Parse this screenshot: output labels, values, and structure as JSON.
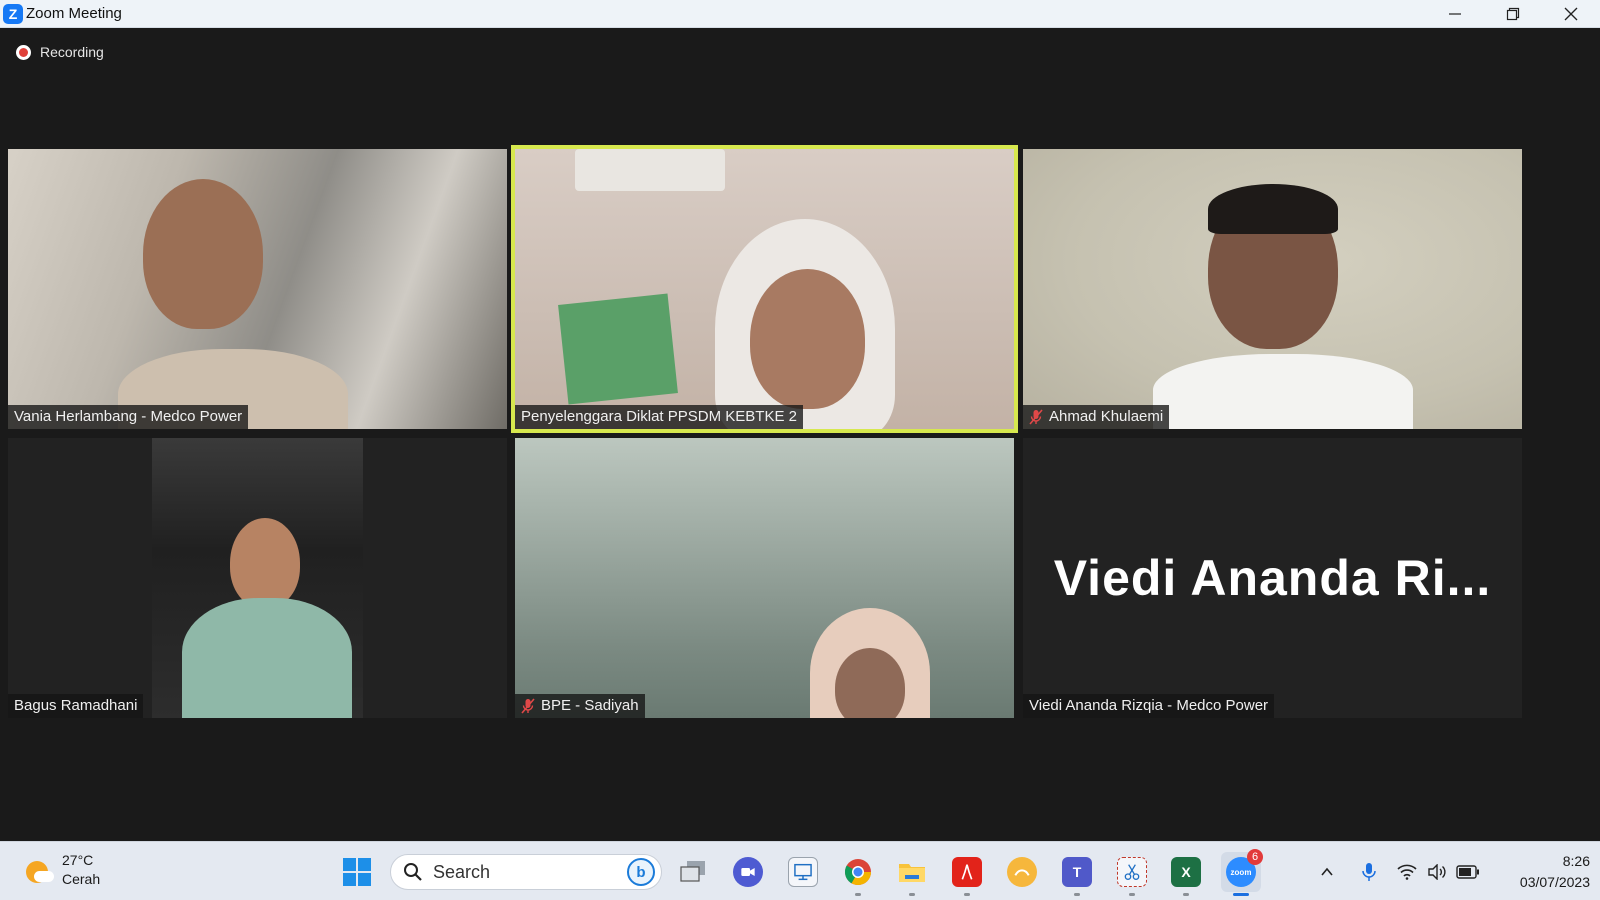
{
  "window": {
    "title": "Zoom Meeting",
    "app_icon_letter": "Z"
  },
  "meeting": {
    "recording_label": "Recording",
    "participants": [
      {
        "name": "Vania Herlambang - Medco Power",
        "muted": false,
        "video": true
      },
      {
        "name": "Penyelenggara Diklat PPSDM KEBTKE 2",
        "muted": false,
        "video": true,
        "active_speaker": true
      },
      {
        "name": "Ahmad Khulaemi",
        "muted": true,
        "video": true
      },
      {
        "name": "Bagus Ramadhani",
        "muted": false,
        "video": true
      },
      {
        "name": "BPE - Sadiyah",
        "muted": true,
        "video": true
      },
      {
        "name": "Viedi Ananda Rizqia - Medco Power",
        "muted": false,
        "video": false,
        "display_name": "Viedi Ananda Ri..."
      }
    ],
    "active_speaker_color": "#d7e84e"
  },
  "taskbar": {
    "weather": {
      "temp": "27°C",
      "condition": "Cerah",
      "icon": "partly-sunny-icon"
    },
    "search": {
      "placeholder": "Search"
    },
    "zoom_badge": "6",
    "apps": [
      "windows-start-icon",
      "task-view-icon",
      "meet-chat-icon",
      "remote-desktop-icon",
      "chrome-icon",
      "file-explorer-icon",
      "pdf-reader-icon",
      "photo-app-icon",
      "teams-icon",
      "snipping-tool-icon",
      "excel-icon",
      "zoom-icon"
    ],
    "clock": {
      "time": "8:26",
      "date": "03/07/2023"
    }
  }
}
